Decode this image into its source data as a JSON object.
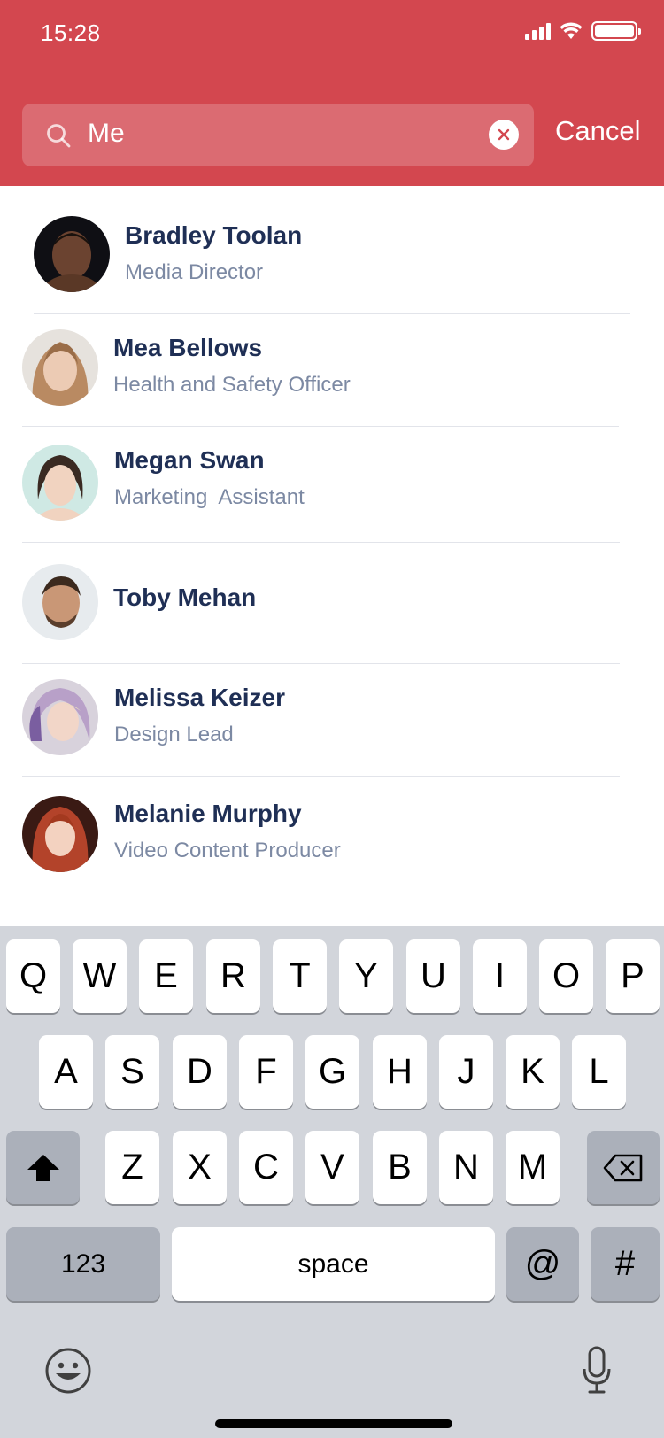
{
  "status": {
    "time": "15:28"
  },
  "search": {
    "query": "Me",
    "cancel_label": "Cancel"
  },
  "results": [
    {
      "name": "Bradley Toolan",
      "role": "Media Director"
    },
    {
      "name": "Mea Bellows",
      "role": "Health and Safety Officer"
    },
    {
      "name": "Megan Swan",
      "role": "Marketing  Assistant"
    },
    {
      "name": "Toby Mehan",
      "role": ""
    },
    {
      "name": "Melissa Keizer",
      "role": "Design Lead"
    },
    {
      "name": "Melanie Murphy",
      "role": "Video Content Producer"
    }
  ],
  "keyboard": {
    "row1": [
      "Q",
      "W",
      "E",
      "R",
      "T",
      "Y",
      "U",
      "I",
      "O",
      "P"
    ],
    "row2": [
      "A",
      "S",
      "D",
      "F",
      "G",
      "H",
      "J",
      "K",
      "L"
    ],
    "row3": [
      "Z",
      "X",
      "C",
      "V",
      "B",
      "N",
      "M"
    ],
    "numbers_label": "123",
    "space_label": "space",
    "at_label": "@",
    "hash_label": "#"
  },
  "colors": {
    "header": "#D3474F",
    "name": "#1F2F55",
    "role": "#7C89A3"
  }
}
